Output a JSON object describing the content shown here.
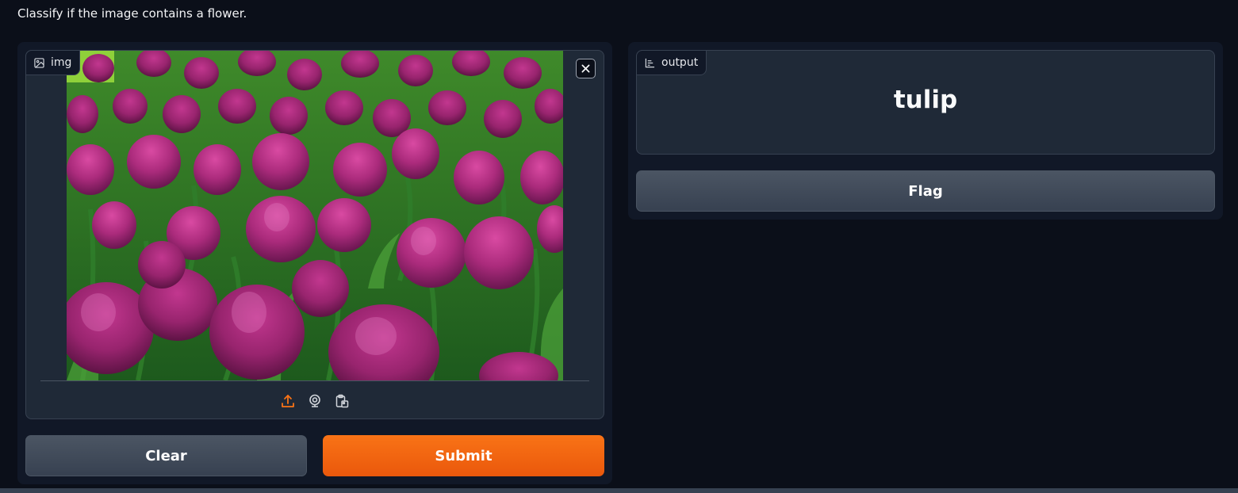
{
  "description": "Classify if the image contains a flower.",
  "input": {
    "label": "img",
    "image_alt": "Field of magenta tulips"
  },
  "output": {
    "label": "output",
    "value": "tulip"
  },
  "buttons": {
    "clear": "Clear",
    "submit": "Submit",
    "flag": "Flag"
  },
  "colors": {
    "accent": "#f97316",
    "background": "#0b0f19",
    "panel": "#111827",
    "block": "#1f2937"
  },
  "icons": {
    "input_label": "image-icon",
    "output_label": "bar-chart-icon",
    "close": "close-icon",
    "sources": [
      "upload-icon",
      "webcam-icon",
      "clipboard-icon"
    ]
  }
}
